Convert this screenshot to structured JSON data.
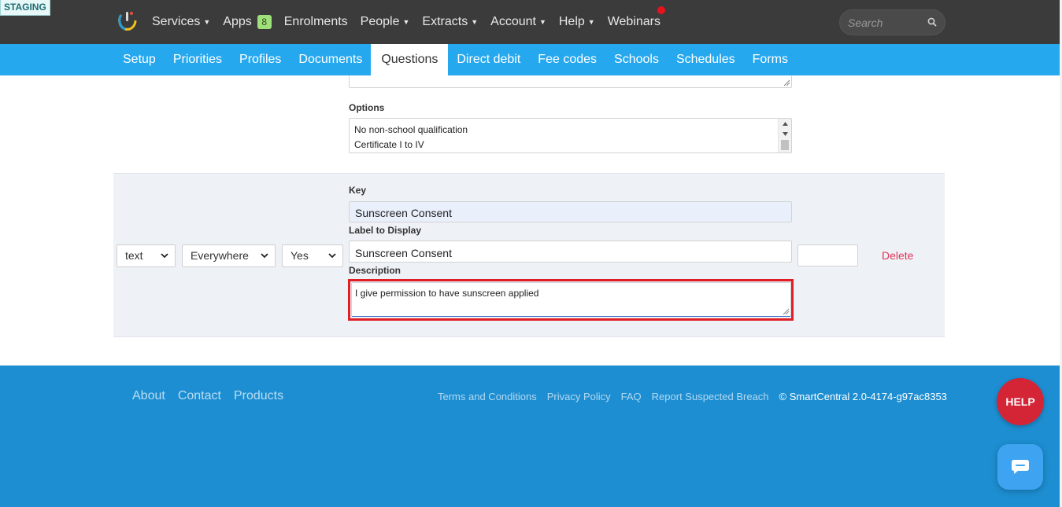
{
  "env_badge": "STAGING",
  "topnav": {
    "items": [
      {
        "label": "Services",
        "caret": true
      },
      {
        "label": "Apps",
        "badge": "8"
      },
      {
        "label": "Enrolments"
      },
      {
        "label": "People",
        "caret": true
      },
      {
        "label": "Extracts",
        "caret": true
      },
      {
        "label": "Account",
        "caret": true
      },
      {
        "label": "Help",
        "caret": true
      },
      {
        "label": "Webinars"
      }
    ],
    "search_placeholder": "Search",
    "notification_color": "#e8121c"
  },
  "subnav": {
    "tabs": [
      "Setup",
      "Priorities",
      "Profiles",
      "Documents",
      "Questions",
      "Direct debit",
      "Fee codes",
      "Schools",
      "Schedules",
      "Forms"
    ],
    "active": "Questions",
    "color": "#26a8ef"
  },
  "question_prev": {
    "options_label": "Options",
    "options_lines": [
      "No non-school qualification",
      "Certificate I to IV"
    ]
  },
  "question_row": {
    "type": "text",
    "visibility": "Everywhere",
    "required": "Yes",
    "key_label": "Key",
    "key_value": "Sunscreen Consent",
    "label_label": "Label to Display",
    "label_value": "Sunscreen Consent",
    "description_label": "Description",
    "description_value": "I give permission to have sunscreen applied",
    "order_value": "",
    "delete_label": "Delete"
  },
  "footer": {
    "left_links": [
      "About",
      "Contact",
      "Products"
    ],
    "right_links": [
      "Terms and Conditions",
      "Privacy Policy",
      "FAQ",
      "Report Suspected Breach"
    ],
    "copyright": "©  SmartCentral 2.0-4174-g97ac8353",
    "color": "#1d8ed1"
  },
  "help_button": "HELP"
}
